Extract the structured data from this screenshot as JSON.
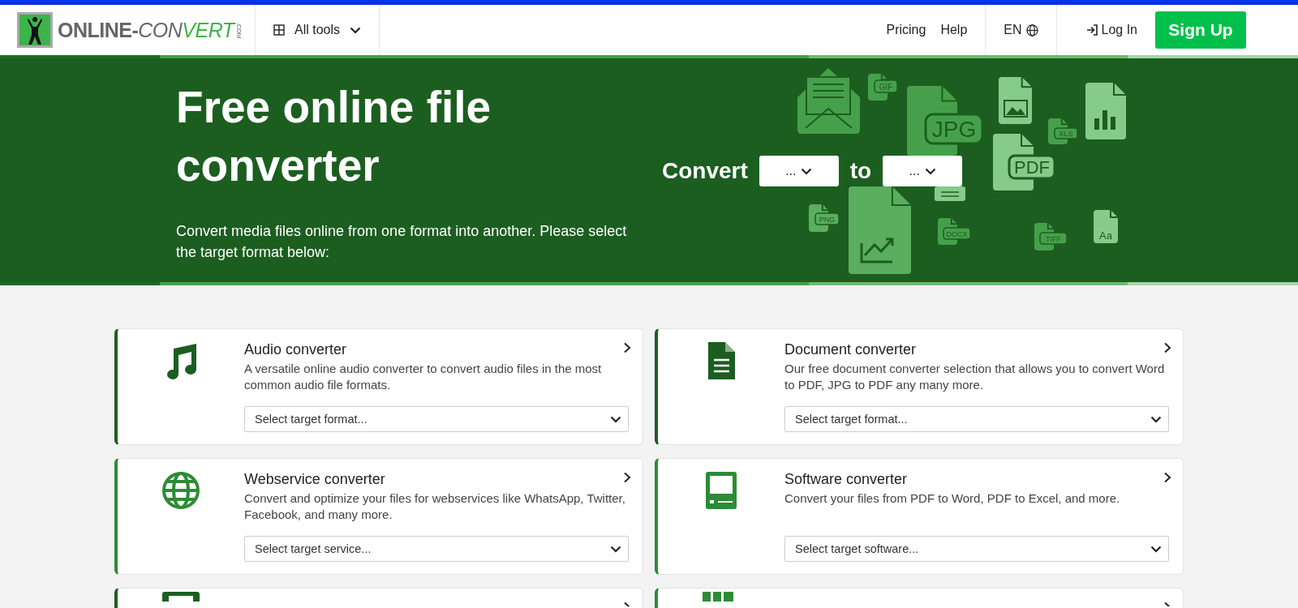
{
  "header": {
    "logo": {
      "parts": [
        "ONLINE-",
        "CON",
        "VERT"
      ],
      "suffix": ".COM"
    },
    "all_tools": "All tools",
    "nav": [
      "Pricing",
      "Help"
    ],
    "language": "EN",
    "login": "Log In",
    "signup": "Sign Up"
  },
  "hero": {
    "title": "Free online file converter",
    "subtitle": "Convert media files online from one format into another. Please select the target format below:",
    "convert_label": "Convert",
    "from_select": "...",
    "to_label": "to",
    "to_select": "...",
    "file_labels": [
      "GIF",
      "JPG",
      "XLS",
      "PDF",
      "PNG",
      "DOCX",
      "TIFF",
      "Aa"
    ]
  },
  "cards": [
    {
      "kind": "audio",
      "color": "#1b5e20",
      "title": "Audio converter",
      "description": "A versatile online audio converter to convert audio files in the most common audio file formats.",
      "select": "Select target format..."
    },
    {
      "kind": "document",
      "color": "#1b5e20",
      "title": "Document converter",
      "description": "Our free document converter selection that allows you to convert Word to PDF, JPG to PDF any many more.",
      "select": "Select target format..."
    },
    {
      "kind": "webservice",
      "color": "#2e8b35",
      "title": "Webservice converter",
      "description": "Convert and optimize your files for webservices like WhatsApp, Twitter, Facebook, and many more.",
      "select": "Select target service..."
    },
    {
      "kind": "software",
      "color": "#2e8b35",
      "title": "Software converter",
      "description": "Convert your files from PDF to Word, PDF to Excel, and more.",
      "select": "Select target software..."
    },
    {
      "kind": "video",
      "color": "#1b5e20"
    },
    {
      "kind": "ebook",
      "color": "#2e8b35"
    }
  ]
}
